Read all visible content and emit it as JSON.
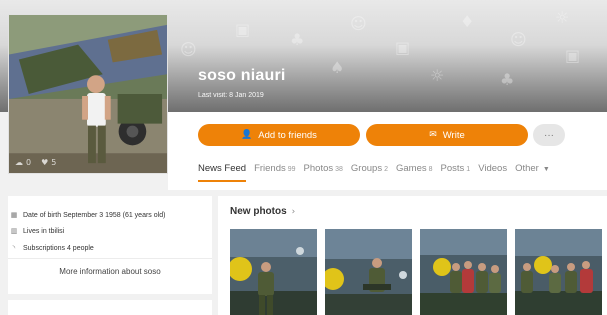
{
  "profile": {
    "name": "soso niauri",
    "last_visit": "Last visit: 8 Jan 2019"
  },
  "avatar": {
    "stats": [
      {
        "icon": "comment-icon",
        "value": "0"
      },
      {
        "icon": "like-icon",
        "value": "5"
      }
    ]
  },
  "actions": {
    "add_friends": "Add to friends",
    "write": "Write",
    "more": "···"
  },
  "tabs": [
    {
      "label": "News Feed",
      "count": ""
    },
    {
      "label": "Friends",
      "count": "99"
    },
    {
      "label": "Photos",
      "count": "38"
    },
    {
      "label": "Groups",
      "count": "2"
    },
    {
      "label": "Games",
      "count": "8"
    },
    {
      "label": "Posts",
      "count": "1"
    },
    {
      "label": "Videos",
      "count": ""
    },
    {
      "label": "Other",
      "count": ""
    }
  ],
  "info": {
    "dob": "Date of birth September 3 1958 (61 years old)",
    "lives": "Lives in tbilisi",
    "subscriptions": "Subscriptions 4 people",
    "more": "More information about soso"
  },
  "new_photos": {
    "title": "New photos",
    "chevron": "›"
  },
  "colors": {
    "accent": "#ee8208",
    "background": "#f1f1f1"
  }
}
